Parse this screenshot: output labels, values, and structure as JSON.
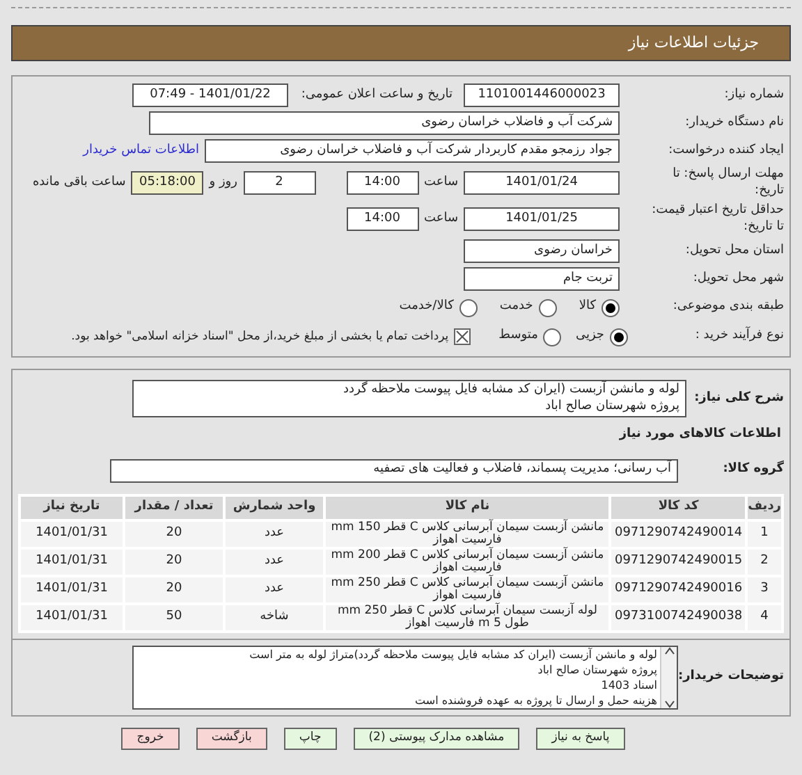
{
  "header": {
    "title": "جزئیات اطلاعات نیاز"
  },
  "need_number": {
    "label": "شماره نیاز:",
    "value": "1101001446000023"
  },
  "announce": {
    "label": "تاریخ و ساعت اعلان عمومی:",
    "value": "1401/01/22 - 07:49"
  },
  "buyer_org": {
    "label": "نام دستگاه خریدار:",
    "value": "شرکت آب و فاضلاب خراسان رضوی"
  },
  "creator": {
    "label": "ایجاد کننده درخواست:",
    "value": "جواد رزمجو مقدم  کاربردار شرکت آب و فاضلاب خراسان رضوی",
    "link": "اطلاعات تماس خریدار"
  },
  "deadline": {
    "label": "مهلت ارسال پاسخ: تا تاریخ:",
    "date": "1401/01/24",
    "time_label": "ساعت",
    "time": "14:00",
    "days": "2",
    "days_label": "روز و",
    "remaining": "05:18:00",
    "remaining_label": "ساعت باقی مانده"
  },
  "validity": {
    "label": "حداقل تاریخ اعتبار قیمت: تا تاریخ:",
    "date": "1401/01/25",
    "time_label": "ساعت",
    "time": "14:00"
  },
  "province": {
    "label": "استان محل تحویل:",
    "value": "خراسان رضوی"
  },
  "city": {
    "label": "شهر محل تحویل:",
    "value": "تربت جام"
  },
  "category": {
    "label": "طبقه بندی موضوعی:",
    "options": [
      {
        "label": "کالا",
        "selected": true
      },
      {
        "label": "خدمت",
        "selected": false
      },
      {
        "label": "کالا/خدمت",
        "selected": false
      }
    ]
  },
  "purchase_type": {
    "label": "نوع فرآیند خرید :",
    "options": [
      {
        "label": "جزیی",
        "selected": true
      },
      {
        "label": "متوسط",
        "selected": false
      }
    ],
    "payment": {
      "checked": true,
      "label": "پرداخت تمام یا بخشی از مبلغ خرید،از محل \"اسناد خزانه اسلامی\" خواهد بود."
    }
  },
  "summary": {
    "label": "شرح کلی نیاز:",
    "lines": [
      "لوله و مانشن آزبست (ایران کد مشابه فایل پیوست ملاحظه گردد",
      "پروژه شهرستان صالح اباد"
    ]
  },
  "goods_title": "اطلاعات کالاهای مورد نیاز",
  "group": {
    "label": "گروه کالا:",
    "value": "آب رسانی؛ مدیریت پسماند، فاضلاب و فعالیت های تصفیه"
  },
  "table": {
    "columns": [
      "ردیف",
      "کد کالا",
      "نام کالا",
      "واحد شمارش",
      "تعداد / مقدار",
      "تاریخ نیاز"
    ],
    "rows": [
      [
        "1",
        "0971290742490014",
        "مانشن آزبست سیمان آبرسانی کلاس C قطر 150 mm فارسیت اهواز",
        "عدد",
        "20",
        "1401/01/31"
      ],
      [
        "2",
        "0971290742490015",
        "مانشن آزبست سیمان آبرسانی کلاس C قطر 200 mm فارسیت اهواز",
        "عدد",
        "20",
        "1401/01/31"
      ],
      [
        "3",
        "0971290742490016",
        "مانشن آزبست سیمان آبرسانی کلاس C قطر 250 mm فارسیت اهواز",
        "عدد",
        "20",
        "1401/01/31"
      ],
      [
        "4",
        "0973100742490038",
        "لوله آزبست سیمان آبرسانی کلاس C قطر 250 mm طول 5 m فارسیت اهواز",
        "شاخه",
        "50",
        "1401/01/31"
      ]
    ]
  },
  "buyer_notes": {
    "label": "توضیحات خریدار:",
    "lines": [
      "لوله و مانشن آزبست (ایران کد مشابه فایل پیوست ملاحظه گردد)متراژ لوله به متر است",
      "پروژه شهرستان صالح اباد",
      "اسناد 1403",
      "هزینه حمل و ارسال تا پروژه به عهده فروشنده است"
    ]
  },
  "buttons": [
    {
      "label": "پاسخ به نیاز",
      "kind": "green"
    },
    {
      "label": "مشاهده مدارک پیوستی (2)",
      "kind": "green"
    },
    {
      "label": "چاپ",
      "kind": "green"
    },
    {
      "label": "بازگشت",
      "kind": "red"
    },
    {
      "label": "خروج",
      "kind": "red"
    }
  ]
}
